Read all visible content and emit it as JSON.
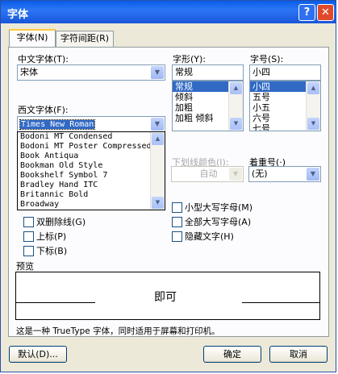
{
  "window": {
    "title": "字体",
    "help_glyph": "?",
    "close_glyph": "✕"
  },
  "tabs": [
    {
      "label": "字体(N)"
    },
    {
      "label": "字符间距(R)"
    }
  ],
  "chinese_font": {
    "label": "中文字体(T):",
    "value": "宋体"
  },
  "style": {
    "label": "字形(Y):",
    "value": "常规",
    "options": [
      "常规",
      "倾斜",
      "加粗",
      "加粗 倾斜"
    ],
    "selected": "常规"
  },
  "size": {
    "label": "字号(S):",
    "value": "小四",
    "options": [
      "小四",
      "五号",
      "小五",
      "六号",
      "七号"
    ],
    "selected": "小四"
  },
  "western_font": {
    "label": "西文字体(F):",
    "value": "Times New Roman",
    "options": [
      "Bodoni MT Condensed",
      "Bodoni MT Poster Compressed",
      "Book Antiqua",
      "Bookman Old Style",
      "Bookshelf Symbol 7",
      "Bradley Hand ITC",
      "Britannic Bold",
      "Broadway"
    ]
  },
  "underline_color": {
    "label": "下划线颜色(I):",
    "value": "自动"
  },
  "emphasis": {
    "label": "着重号(·)",
    "value": "(无)"
  },
  "effects": {
    "double_strikethrough": "双删除线(G)",
    "superscript": "上标(P)",
    "subscript": "下标(B)",
    "small_caps": "小型大写字母(M)",
    "all_caps": "全部大写字母(A)",
    "hidden": "隐藏文字(H)"
  },
  "preview": {
    "label": "预览",
    "text": "即可",
    "note": "这是一种 TrueType 字体，同时适用于屏幕和打印机。"
  },
  "buttons": {
    "default": "默认(D)...",
    "ok": "确定",
    "cancel": "取消"
  },
  "icons": {
    "dropdown": "▼",
    "scroll_up": "▲",
    "scroll_down": "▼"
  }
}
